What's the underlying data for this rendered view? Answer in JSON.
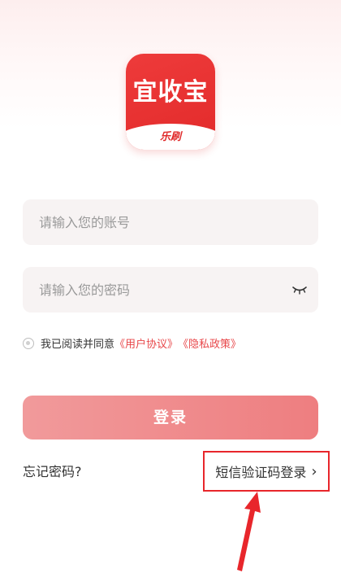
{
  "app": {
    "logo_title": "宜收宝",
    "logo_subtitle": "乐刷",
    "brand_color": "#e22a2a"
  },
  "form": {
    "account_placeholder": "请输入您的账号",
    "password_placeholder": "请输入您的密码",
    "password_toggle_icon": "eye-closed-icon"
  },
  "agreement": {
    "prefix": "我已阅读并同意",
    "user_agreement": "《用户协议》",
    "privacy_policy": "《隐私政策》",
    "link_color": "#e8474a"
  },
  "actions": {
    "login_label": "登录",
    "forgot_password": "忘记密码?",
    "sms_login": "短信验证码登录",
    "sms_chevron": "›"
  },
  "annotation": {
    "highlight_color": "#e8262b"
  }
}
